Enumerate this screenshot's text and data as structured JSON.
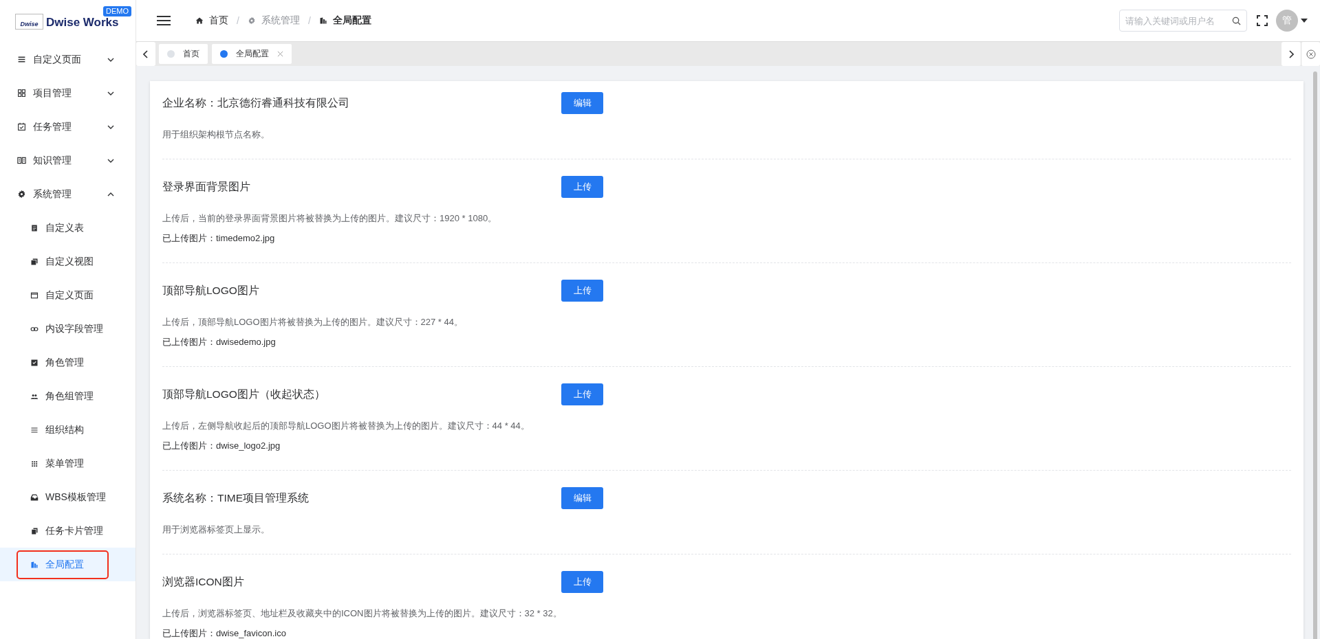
{
  "sidebar": {
    "logo": {
      "mark": "Dwise",
      "name": "Dwise Works",
      "badge": "DEMO"
    },
    "menu": [
      {
        "label": "自定义页面",
        "expanded": false
      },
      {
        "label": "项目管理",
        "expanded": false
      },
      {
        "label": "任务管理",
        "expanded": false
      },
      {
        "label": "知识管理",
        "expanded": false
      },
      {
        "label": "系统管理",
        "expanded": true,
        "children": [
          {
            "label": "自定义表",
            "selected": false
          },
          {
            "label": "自定义视图",
            "selected": false
          },
          {
            "label": "自定义页面",
            "selected": false
          },
          {
            "label": "内设字段管理",
            "selected": false
          },
          {
            "label": "角色管理",
            "selected": false
          },
          {
            "label": "角色组管理",
            "selected": false
          },
          {
            "label": "组织结构",
            "selected": false
          },
          {
            "label": "菜单管理",
            "selected": false
          },
          {
            "label": "WBS模板管理",
            "selected": false
          },
          {
            "label": "任务卡片管理",
            "selected": false
          },
          {
            "label": "全局配置",
            "selected": true
          }
        ]
      }
    ]
  },
  "header": {
    "breadcrumb": [
      {
        "label": "首页",
        "current": false,
        "link": true
      },
      {
        "separator": "/",
        "label": "系统管理",
        "current": false,
        "link": false
      },
      {
        "separator": "/",
        "label": "全局配置",
        "current": true,
        "link": false
      }
    ],
    "search": {
      "placeholder": "请输入关键词或用户名"
    },
    "avatar": "管"
  },
  "tabs": [
    {
      "label": "首页",
      "selected": false,
      "closable": false
    },
    {
      "label": "全局配置",
      "selected": true,
      "closable": true
    }
  ],
  "sections": [
    {
      "title": "企业名称：北京德衍睿通科技有限公司",
      "button": "编辑",
      "description": "用于组织架构根节点名称。"
    },
    {
      "title": "登录界面背景图片",
      "button": "上传",
      "description": "上传后，当前的登录界面背景图片将被替换为上传的图片。建议尺寸：1920 * 1080。",
      "uploaded": "已上传图片：timedemo2.jpg"
    },
    {
      "title": "顶部导航LOGO图片",
      "button": "上传",
      "description": "上传后，顶部导航LOGO图片将被替换为上传的图片。建议尺寸：227 * 44。",
      "uploaded": "已上传图片：dwisedemo.jpg"
    },
    {
      "title": "顶部导航LOGO图片（收起状态）",
      "button": "上传",
      "description": "上传后，左侧导航收起后的顶部导航LOGO图片将被替换为上传的图片。建议尺寸：44 * 44。",
      "uploaded": "已上传图片：dwise_logo2.jpg"
    },
    {
      "title": "系统名称：TIME项目管理系统",
      "button": "编辑",
      "description": "用于浏览器标签页上显示。"
    },
    {
      "title": "浏览器ICON图片",
      "button": "上传",
      "description": "上传后，浏览器标签页、地址栏及收藏夹中的ICON图片将被替换为上传的图片。建议尺寸：32 * 32。",
      "uploaded": "已上传图片：dwise_favicon.ico"
    }
  ]
}
